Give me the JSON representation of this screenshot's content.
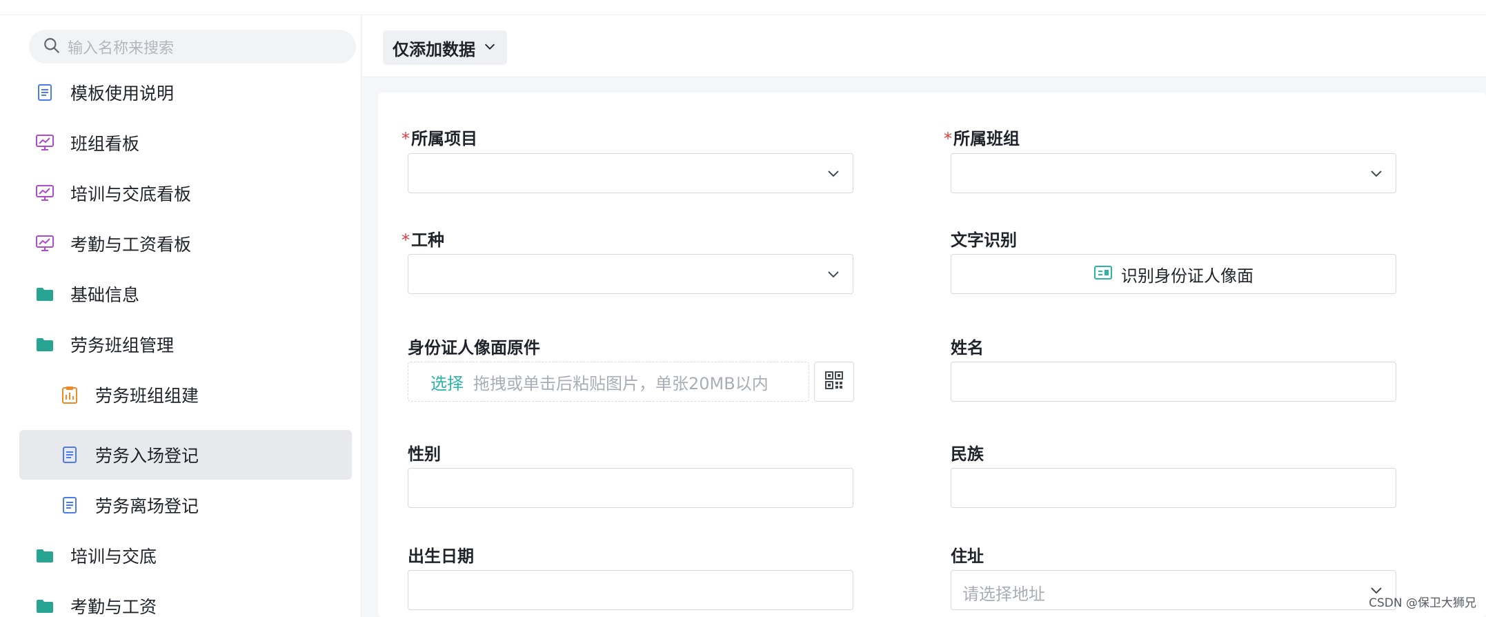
{
  "search": {
    "placeholder": "输入名称来搜索",
    "icon": "search-icon"
  },
  "sidebar": {
    "items": [
      {
        "label": "模板使用说明",
        "icon": "document-icon",
        "color": "#4a7cf0",
        "level": 0
      },
      {
        "label": "班组看板",
        "icon": "dashboard-icon",
        "color": "#b04ad0",
        "level": 0
      },
      {
        "label": "培训与交底看板",
        "icon": "dashboard-icon",
        "color": "#b04ad0",
        "level": 0
      },
      {
        "label": "考勤与工资看板",
        "icon": "dashboard-icon",
        "color": "#b04ad0",
        "level": 0
      },
      {
        "label": "基础信息",
        "icon": "folder-icon",
        "color": "#27a592",
        "level": 0
      },
      {
        "label": "劳务班组管理",
        "icon": "folder-icon",
        "color": "#27a592",
        "level": 0
      },
      {
        "label": "劳务班组组建",
        "icon": "clipboard-icon",
        "color": "#f08a24",
        "level": 1
      },
      {
        "label": "劳务入场登记",
        "icon": "document-icon",
        "color": "#4a7cf0",
        "level": 1,
        "active": true
      },
      {
        "label": "劳务离场登记",
        "icon": "document-icon",
        "color": "#4a7cf0",
        "level": 1
      },
      {
        "label": "培训与交底",
        "icon": "folder-icon",
        "color": "#27a592",
        "level": 0
      },
      {
        "label": "考勤与工资",
        "icon": "folder-icon",
        "color": "#27a592",
        "level": 0
      }
    ]
  },
  "toolbar": {
    "dropdown_label": "仅添加数据"
  },
  "form": {
    "project": {
      "label": "所属项目",
      "required": true
    },
    "team": {
      "label": "所属班组",
      "required": true
    },
    "worktype": {
      "label": "工种",
      "required": true
    },
    "ocr": {
      "label": "文字识别",
      "button": "识别身份证人像面"
    },
    "id_photo": {
      "label": "身份证人像面原件",
      "select": "选择",
      "hint": "拖拽或单击后粘贴图片，单张20MB以内"
    },
    "name": {
      "label": "姓名"
    },
    "gender": {
      "label": "性别"
    },
    "ethnicity": {
      "label": "民族"
    },
    "birthdate": {
      "label": "出生日期"
    },
    "address": {
      "label": "住址",
      "placeholder": "请选择地址"
    }
  },
  "watermark": "CSDN @保卫大狮兄",
  "colors": {
    "required": "#e03e3e",
    "accent": "#2bb5a6",
    "active_bg": "#e8e9ec"
  }
}
